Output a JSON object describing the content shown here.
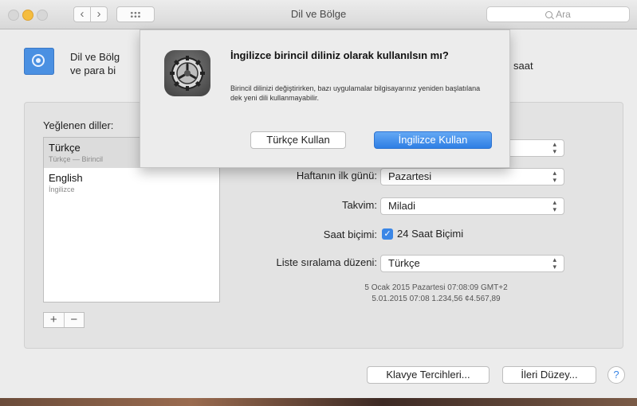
{
  "window": {
    "title": "Dil ve Bölge",
    "search_placeholder": "Ara",
    "nav": {
      "back": "‹",
      "forward": "›"
    }
  },
  "header": {
    "line1": "Dil ve Bölg",
    "line2": "ve para bi",
    "right_fragment": "saat"
  },
  "preferred_languages": {
    "label": "Yeğlenen diller:",
    "items": [
      {
        "name": "Türkçe",
        "sub": "Türkçe — Birincil"
      },
      {
        "name": "English",
        "sub": "İngilizce"
      }
    ],
    "add": "+",
    "remove": "−"
  },
  "settings": {
    "first_day_label": "Haftanın ilk günü:",
    "first_day_value": "Pazartesi",
    "calendar_label": "Takvim:",
    "calendar_value": "Miladi",
    "time_format_label": "Saat biçimi:",
    "time_format_checkbox": "24 Saat Biçimi",
    "time_format_checked": true,
    "sort_label": "Liste sıralama düzeni:",
    "sort_value": "Türkçe",
    "hidden_popup_chevron": "⌃⌄"
  },
  "sample": {
    "line1": "5 Ocak 2015 Pazartesi 07:08:09 GMT+2",
    "line2": "5.01.2015 07:08    1.234,56    ¢4.567,89"
  },
  "footer": {
    "keyboard_button": "Klavye Tercihleri...",
    "advanced_button": "İleri Düzey...",
    "help": "?"
  },
  "dialog": {
    "title": "İngilizce birincil diliniz olarak kullanılsın mı?",
    "message": "Birincil dilinizi değiştirirken, bazı uygulamalar bilgisayarınız yeniden başlatılana dek yeni dili kullanmayabilir.",
    "secondary_button": "Türkçe Kullan",
    "primary_button": "İngilizce Kullan"
  },
  "colors": {
    "accent": "#3a86e6",
    "minimize": "#f5bd3f"
  }
}
